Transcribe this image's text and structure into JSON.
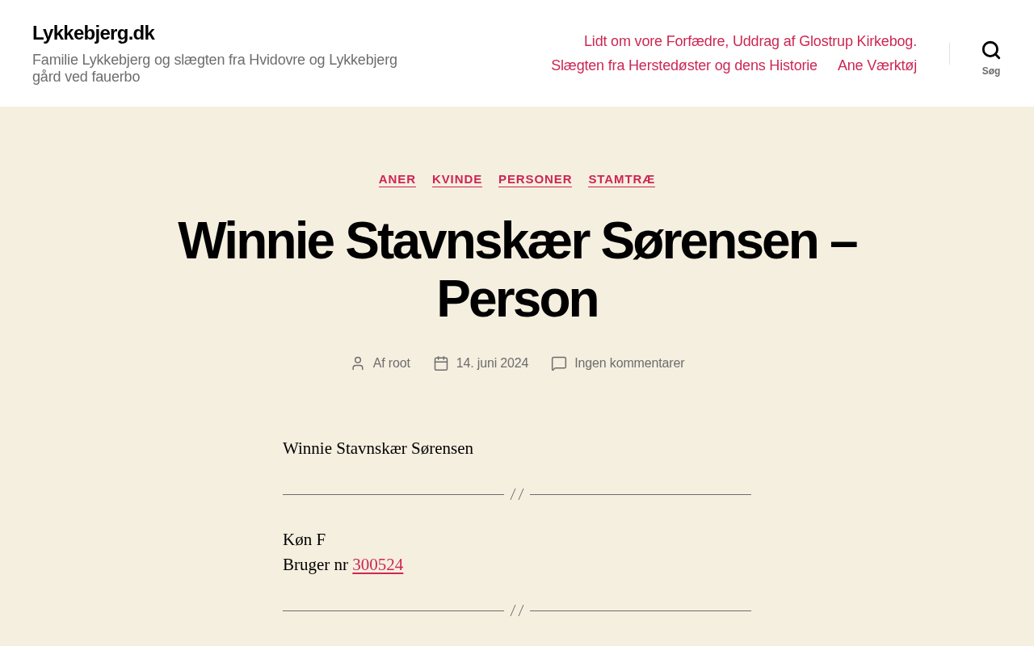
{
  "site": {
    "title": "Lykkebjerg.dk",
    "description": "Familie Lykkebjerg og slægten fra Hvidovre og Lykkebjerg gård ved fauerbo"
  },
  "nav": {
    "items": [
      {
        "label": "Lidt om vore Forfædre, Uddrag af Glostrup Kirkebog."
      },
      {
        "label": "Slægten fra Herstedøster og dens Historie"
      },
      {
        "label": "Ane Værktøj"
      }
    ]
  },
  "search_toggle": {
    "label": "Søg"
  },
  "post": {
    "categories": [
      "ANER",
      "KVINDE",
      "PERSONER",
      "STAMTRÆ"
    ],
    "title": "Winnie Stavnskær Sørensen – Person",
    "meta": [
      {
        "kind": "author",
        "text": "Af root"
      },
      {
        "kind": "date",
        "text": "14. juni 2024"
      },
      {
        "kind": "comments",
        "text": "Ingen kommentarer"
      }
    ],
    "content": [
      {
        "kind": "paragraph",
        "text": "Winnie Stavnskær Sørensen"
      },
      {
        "kind": "separator"
      },
      {
        "kind": "lines",
        "lines": [
          {
            "text": "Køn F"
          },
          {
            "text": "Bruger nr",
            "link": "300524"
          }
        ]
      },
      {
        "kind": "separator"
      }
    ]
  }
}
